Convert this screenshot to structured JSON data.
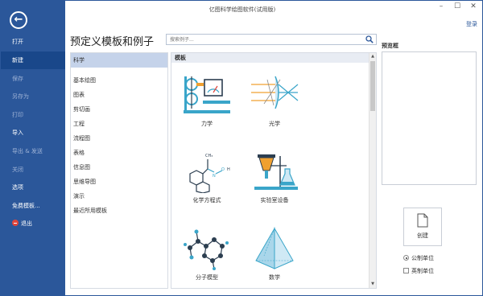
{
  "window": {
    "title": "亿图科学绘图软件(试用版)",
    "minimize_glyph": "–",
    "maximize_glyph": "☐",
    "close_glyph": "✕",
    "login_label": "登录"
  },
  "sidebar": {
    "back_glyph": "←",
    "items": [
      {
        "label": "打开",
        "state": "normal"
      },
      {
        "label": "新建",
        "state": "active"
      },
      {
        "label": "保存",
        "state": "disabled"
      },
      {
        "label": "另存为",
        "state": "disabled"
      },
      {
        "label": "打印",
        "state": "disabled"
      },
      {
        "label": "导入",
        "state": "normal"
      },
      {
        "label": "导出 & 发送",
        "state": "disabled"
      },
      {
        "label": "关闭",
        "state": "disabled"
      },
      {
        "label": "选项",
        "state": "normal"
      },
      {
        "label": "免费模板...",
        "state": "normal"
      },
      {
        "label": "退出",
        "state": "normal"
      }
    ]
  },
  "header": {
    "page_title": "预定义模板和例子",
    "search_placeholder": "搜索例子..."
  },
  "categories": {
    "items": [
      "科学",
      "基本绘图",
      "图表",
      "剪切画",
      "工程",
      "流程图",
      "表格",
      "信息图",
      "思维导图",
      "演示",
      "最近所用模板"
    ],
    "selected": "科学"
  },
  "templates": {
    "section_title": "模板",
    "items": [
      {
        "label": "力学",
        "icon": "mechanics-icon"
      },
      {
        "label": "光学",
        "icon": "optics-icon"
      },
      {
        "label": "化学方程式",
        "icon": "chemical-equation-icon"
      },
      {
        "label": "实验室设备",
        "icon": "lab-equipment-icon"
      },
      {
        "label": "分子模型",
        "icon": "molecule-model-icon"
      },
      {
        "label": "数学",
        "icon": "math-pyramid-icon"
      }
    ]
  },
  "preview": {
    "label": "预览框",
    "create_label": "创建",
    "units": [
      {
        "label": "公制单位",
        "type": "radio",
        "checked": true
      },
      {
        "label": "英制单位",
        "type": "checkbox",
        "checked": false
      }
    ]
  },
  "colors": {
    "sidebar": "#2b579a",
    "sidebar_active": "#19478a",
    "accent_teal": "#3aa5c9",
    "accent_orange": "#f0a030",
    "selected_category": "#c5d3ea"
  }
}
